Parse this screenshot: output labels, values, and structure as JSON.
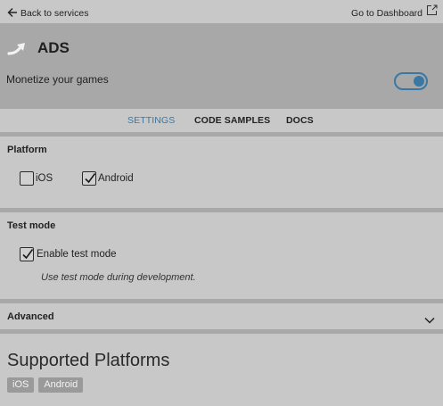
{
  "nav": {
    "back_label": "Back to services",
    "dashboard_label": "Go to Dashboard"
  },
  "header": {
    "title": "ADS",
    "monetize_label": "Monetize your games",
    "monetize_enabled": true,
    "accent_color": "#3a78a3"
  },
  "tabs": [
    {
      "label": "SETTINGS",
      "active": true
    },
    {
      "label": "CODE SAMPLES",
      "active": false
    },
    {
      "label": "DOCS",
      "active": false
    }
  ],
  "platform": {
    "title": "Platform",
    "options": [
      {
        "label": "iOS",
        "checked": false
      },
      {
        "label": "Android",
        "checked": true
      }
    ]
  },
  "test_mode": {
    "title": "Test mode",
    "option_label": "Enable test mode",
    "checked": true,
    "hint": "Use test mode during development."
  },
  "advanced": {
    "label": "Advanced"
  },
  "supported": {
    "title": "Supported Platforms",
    "tags": [
      "iOS",
      "Android"
    ]
  }
}
